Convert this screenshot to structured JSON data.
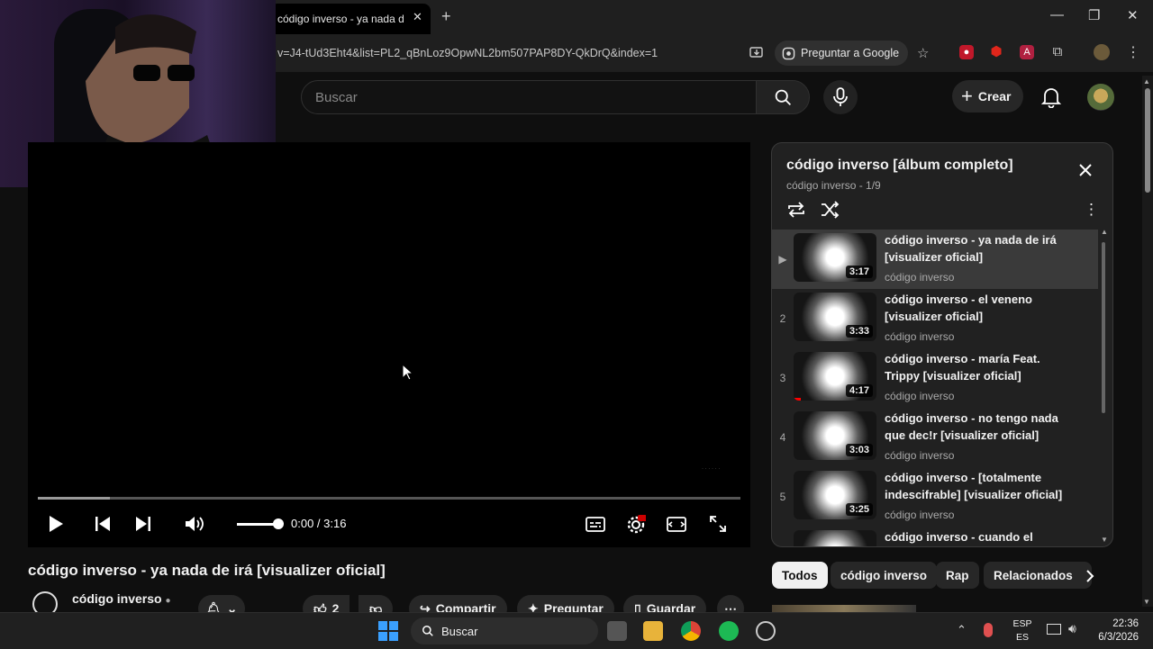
{
  "browser": {
    "tab_title": "código inverso - ya nada de irá",
    "url": "v=J4-tUd3Eht4&list=PL2_qBnLoz9OpwNL2bm507PAP8DY-QkDrQ&index=1",
    "ask_google": "Preguntar a Google"
  },
  "header": {
    "search_placeholder": "Buscar",
    "create_label": "Crear"
  },
  "player": {
    "time": "0:00 / 3:16",
    "progress_played": 0.0,
    "volume_level": 1.0
  },
  "video": {
    "title": "código inverso - ya nada de irá [visualizer oficial]",
    "channel": "código inverso",
    "likes": "2",
    "share_label": "Compartir",
    "ask_label": "Preguntar",
    "save_label": "Guardar"
  },
  "playlist": {
    "title": "código inverso  [álbum completo]",
    "subtitle": "código inverso - 1/9",
    "items": [
      {
        "index": "▶",
        "title": "código inverso - ya nada de irá [visualizer oficial]",
        "channel": "código inverso",
        "duration": "3:17"
      },
      {
        "index": "2",
        "title": "código inverso - el veneno [visualizer oficial]",
        "channel": "código inverso",
        "duration": "3:33"
      },
      {
        "index": "3",
        "title": "código inverso - maría Feat. Trippy [visualizer oficial]",
        "channel": "código inverso",
        "duration": "4:17"
      },
      {
        "index": "4",
        "title": "código inverso - no tengo nada que dec!r [visualizer oficial]",
        "channel": "código inverso",
        "duration": "3:03"
      },
      {
        "index": "5",
        "title": "código inverso - [totalmente indescifrable] [visualizer oficial]",
        "channel": "código inverso",
        "duration": "3:25"
      },
      {
        "index": "",
        "title": "código inverso - cuando el",
        "channel": "",
        "duration": ""
      }
    ]
  },
  "chips": [
    "Todos",
    "código inverso",
    "Rap",
    "Relacionados"
  ],
  "taskbar": {
    "search": "Buscar",
    "lang_top": "ESP",
    "lang_bottom": "ES",
    "time": "22:36",
    "date": "6/3/2026"
  }
}
